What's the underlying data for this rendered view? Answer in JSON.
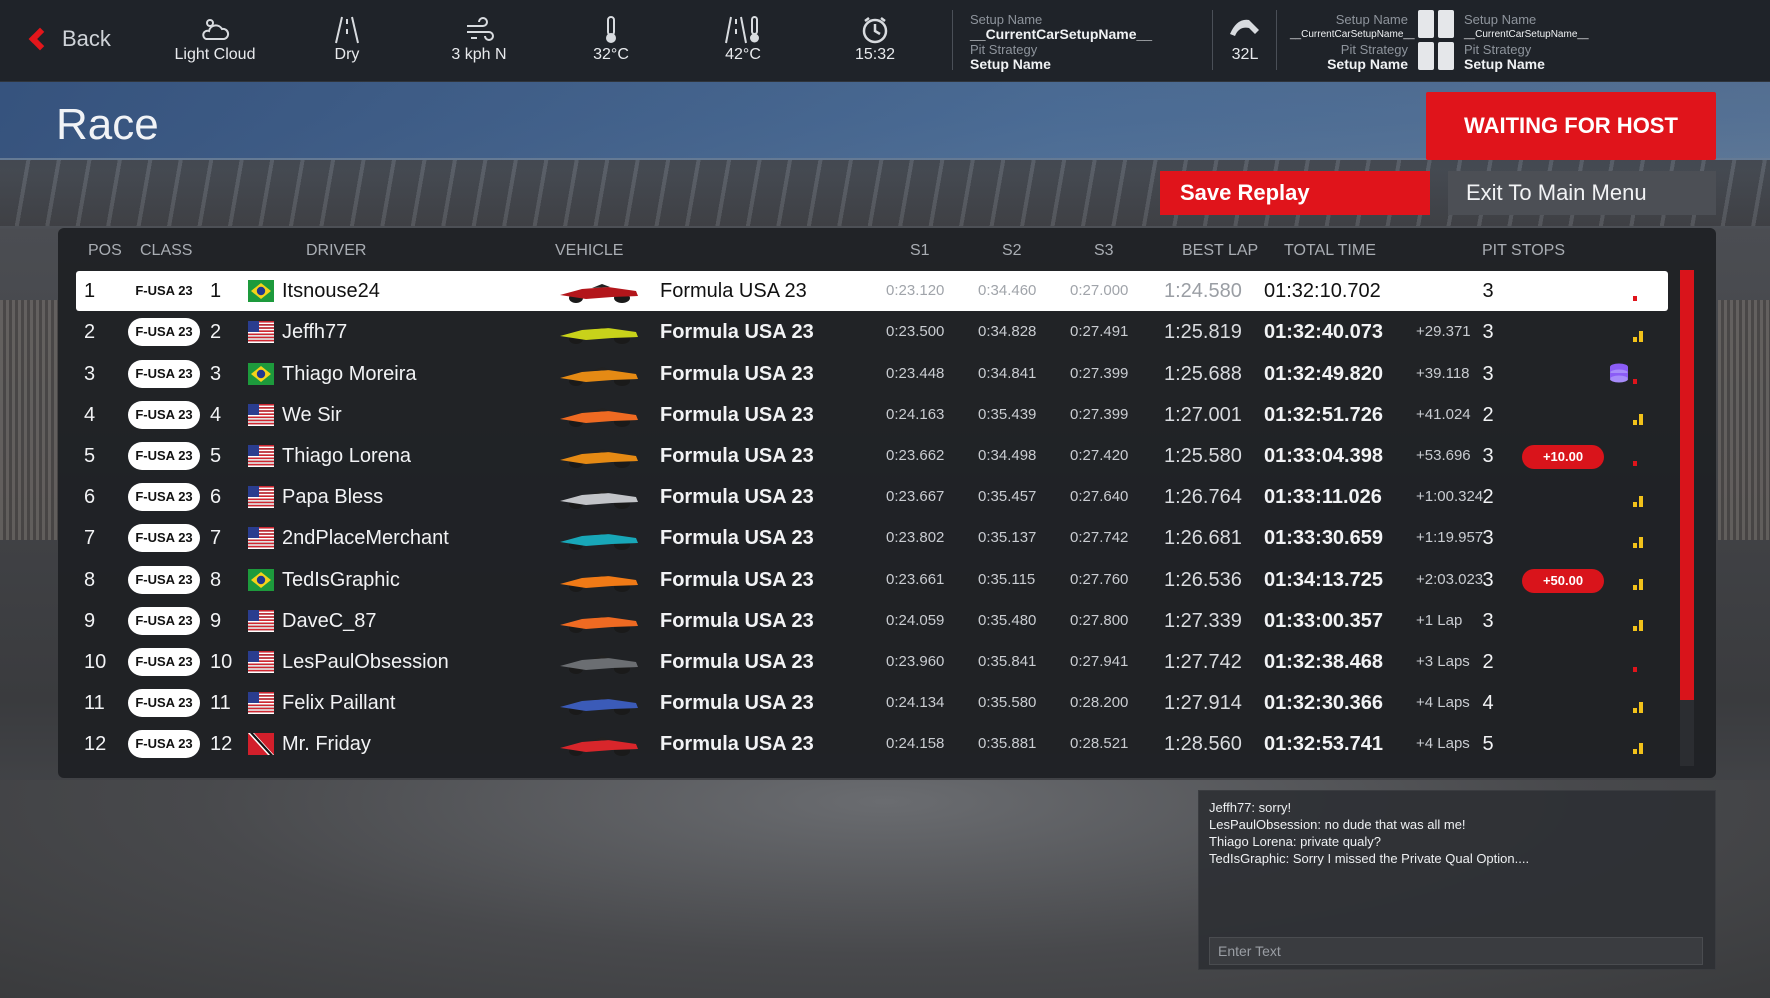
{
  "topbar": {
    "back_label": "Back",
    "weather": [
      {
        "icon": "cloud-icon",
        "label": "Light Cloud"
      },
      {
        "icon": "road-dry-icon",
        "label": "Dry"
      },
      {
        "icon": "wind-icon",
        "label": "3 kph N"
      },
      {
        "icon": "air-temp-icon",
        "label": "32°C"
      },
      {
        "icon": "track-temp-icon",
        "label": "42°C"
      },
      {
        "icon": "clock-icon",
        "label": "15:32"
      }
    ],
    "setup_main": {
      "setup_name_label": "Setup Name",
      "setup_name_value": "__CurrentCarSetupName__",
      "pit_strategy_label": "Pit Strategy",
      "pit_strategy_value": "Setup Name"
    },
    "fuel": {
      "icon": "fuel-icon",
      "label": "32L"
    },
    "setup_left": {
      "setup_name_label": "Setup Name",
      "setup_name_value": "__CurrentCarSetupName__",
      "pit_strategy_label": "Pit Strategy",
      "pit_strategy_value": "Setup Name"
    },
    "setup_right": {
      "setup_name_label": "Setup Name",
      "setup_name_value": "__CurrentCarSetupName__",
      "pit_strategy_label": "Pit Strategy",
      "pit_strategy_value": "Setup Name"
    }
  },
  "page": {
    "title": "Race",
    "host_button": "WAITING FOR HOST",
    "save_replay": "Save Replay",
    "exit_main": "Exit To Main Menu"
  },
  "table": {
    "headers": {
      "pos": "POS",
      "class": "CLASS",
      "driver": "DRIVER",
      "vehicle": "VEHICLE",
      "s1": "S1",
      "s2": "S2",
      "s3": "S3",
      "best": "BEST LAP",
      "total": "TOTAL TIME",
      "pits": "PIT STOPS"
    },
    "rows": [
      {
        "pos": "1",
        "class": "F-USA 23",
        "num": "1",
        "flag": "brazil-flag",
        "driver": "Itsnouse24",
        "livery": "#b3161b",
        "vehicle": "Formula USA 23",
        "s1": "0:23.120",
        "s2": "0:34.460",
        "s3": "0:27.000",
        "best": "1:24.580",
        "total": "01:32:10.702",
        "gap": "",
        "pits": "3",
        "penalty": "",
        "signal": 1
      },
      {
        "pos": "2",
        "class": "F-USA 23",
        "num": "2",
        "flag": "usa-flag",
        "driver": "Jeffh77",
        "livery": "#c8d21a",
        "vehicle": "Formula USA 23",
        "s1": "0:23.500",
        "s2": "0:34.828",
        "s3": "0:27.491",
        "best": "1:25.819",
        "total": "01:32:40.073",
        "gap": "+29.371",
        "pits": "3",
        "penalty": "",
        "signal": 2
      },
      {
        "pos": "3",
        "class": "F-USA 23",
        "num": "3",
        "flag": "brazil-flag",
        "driver": "Thiago Moreira",
        "livery": "#e58a14",
        "vehicle": "Formula USA 23",
        "s1": "0:23.448",
        "s2": "0:34.841",
        "s3": "0:27.399",
        "best": "1:25.688",
        "total": "01:32:49.820",
        "gap": "+39.118",
        "pits": "3",
        "penalty": "",
        "signal": 1
      },
      {
        "pos": "4",
        "class": "F-USA 23",
        "num": "4",
        "flag": "usa-flag",
        "driver": "We Sir",
        "livery": "#ee6a22",
        "vehicle": "Formula USA 23",
        "s1": "0:24.163",
        "s2": "0:35.439",
        "s3": "0:27.399",
        "best": "1:27.001",
        "total": "01:32:51.726",
        "gap": "+41.024",
        "pits": "2",
        "penalty": "",
        "signal": 2
      },
      {
        "pos": "5",
        "class": "F-USA 23",
        "num": "5",
        "flag": "usa-flag",
        "driver": "Thiago Lorena",
        "livery": "#e58a14",
        "vehicle": "Formula USA 23",
        "s1": "0:23.662",
        "s2": "0:34.498",
        "s3": "0:27.420",
        "best": "1:25.580",
        "total": "01:33:04.398",
        "gap": "+53.696",
        "pits": "3",
        "penalty": "+10.00",
        "signal": 1
      },
      {
        "pos": "6",
        "class": "F-USA 23",
        "num": "6",
        "flag": "usa-flag",
        "driver": "Papa Bless",
        "livery": "#c2c4c8",
        "vehicle": "Formula USA 23",
        "s1": "0:23.667",
        "s2": "0:35.457",
        "s3": "0:27.640",
        "best": "1:26.764",
        "total": "01:33:11.026",
        "gap": "+1:00.324",
        "pits": "2",
        "penalty": "",
        "signal": 2
      },
      {
        "pos": "7",
        "class": "F-USA 23",
        "num": "7",
        "flag": "usa-flag",
        "driver": "2ndPlaceMerchant",
        "livery": "#18a7b8",
        "vehicle": "Formula USA 23",
        "s1": "0:23.802",
        "s2": "0:35.137",
        "s3": "0:27.742",
        "best": "1:26.681",
        "total": "01:33:30.659",
        "gap": "+1:19.957",
        "pits": "3",
        "penalty": "",
        "signal": 2
      },
      {
        "pos": "8",
        "class": "F-USA 23",
        "num": "8",
        "flag": "brazil-flag",
        "driver": "TedIsGraphic",
        "livery": "#f07a16",
        "vehicle": "Formula USA 23",
        "s1": "0:23.661",
        "s2": "0:35.115",
        "s3": "0:27.760",
        "best": "1:26.536",
        "total": "01:34:13.725",
        "gap": "+2:03.023",
        "pits": "3",
        "penalty": "+50.00",
        "signal": 2
      },
      {
        "pos": "9",
        "class": "F-USA 23",
        "num": "9",
        "flag": "usa-flag",
        "driver": "DaveC_87",
        "livery": "#ee6a22",
        "vehicle": "Formula USA 23",
        "s1": "0:24.059",
        "s2": "0:35.480",
        "s3": "0:27.800",
        "best": "1:27.339",
        "total": "01:33:00.357",
        "gap": "+1 Lap",
        "pits": "3",
        "penalty": "",
        "signal": 2
      },
      {
        "pos": "10",
        "class": "F-USA 23",
        "num": "10",
        "flag": "usa-flag",
        "driver": "LesPaulObsession",
        "livery": "#6b6e72",
        "vehicle": "Formula USA 23",
        "s1": "0:23.960",
        "s2": "0:35.841",
        "s3": "0:27.941",
        "best": "1:27.742",
        "total": "01:32:38.468",
        "gap": "+3 Laps",
        "pits": "2",
        "penalty": "",
        "signal": 1
      },
      {
        "pos": "11",
        "class": "F-USA 23",
        "num": "11",
        "flag": "usa-flag",
        "driver": "Felix Paillant",
        "livery": "#3b5bb8",
        "vehicle": "Formula USA 23",
        "s1": "0:24.134",
        "s2": "0:35.580",
        "s3": "0:28.200",
        "best": "1:27.914",
        "total": "01:32:30.366",
        "gap": "+4 Laps",
        "pits": "4",
        "penalty": "",
        "signal": 2
      },
      {
        "pos": "12",
        "class": "F-USA 23",
        "num": "12",
        "flag": "trinidad-flag",
        "driver": "Mr. Friday",
        "livery": "#d8262b",
        "vehicle": "Formula USA 23",
        "s1": "0:24.158",
        "s2": "0:35.881",
        "s3": "0:28.521",
        "best": "1:28.560",
        "total": "01:32:53.741",
        "gap": "+4 Laps",
        "pits": "5",
        "penalty": "",
        "signal": 2
      }
    ]
  },
  "chat": {
    "messages": [
      "Jeffh77: sorry!",
      "LesPaulObsession: no dude that was all me!",
      "Thiago Lorena: private qualy?",
      "TedIsGraphic: Sorry I missed the Private Qual Option...."
    ],
    "input_placeholder": "Enter Text"
  },
  "colors": {
    "accent_red": "#e0141b",
    "signal_yellow": "#f2c21a",
    "signal_red": "#e0141b",
    "pitstop_purple": "#8b5cf6"
  }
}
